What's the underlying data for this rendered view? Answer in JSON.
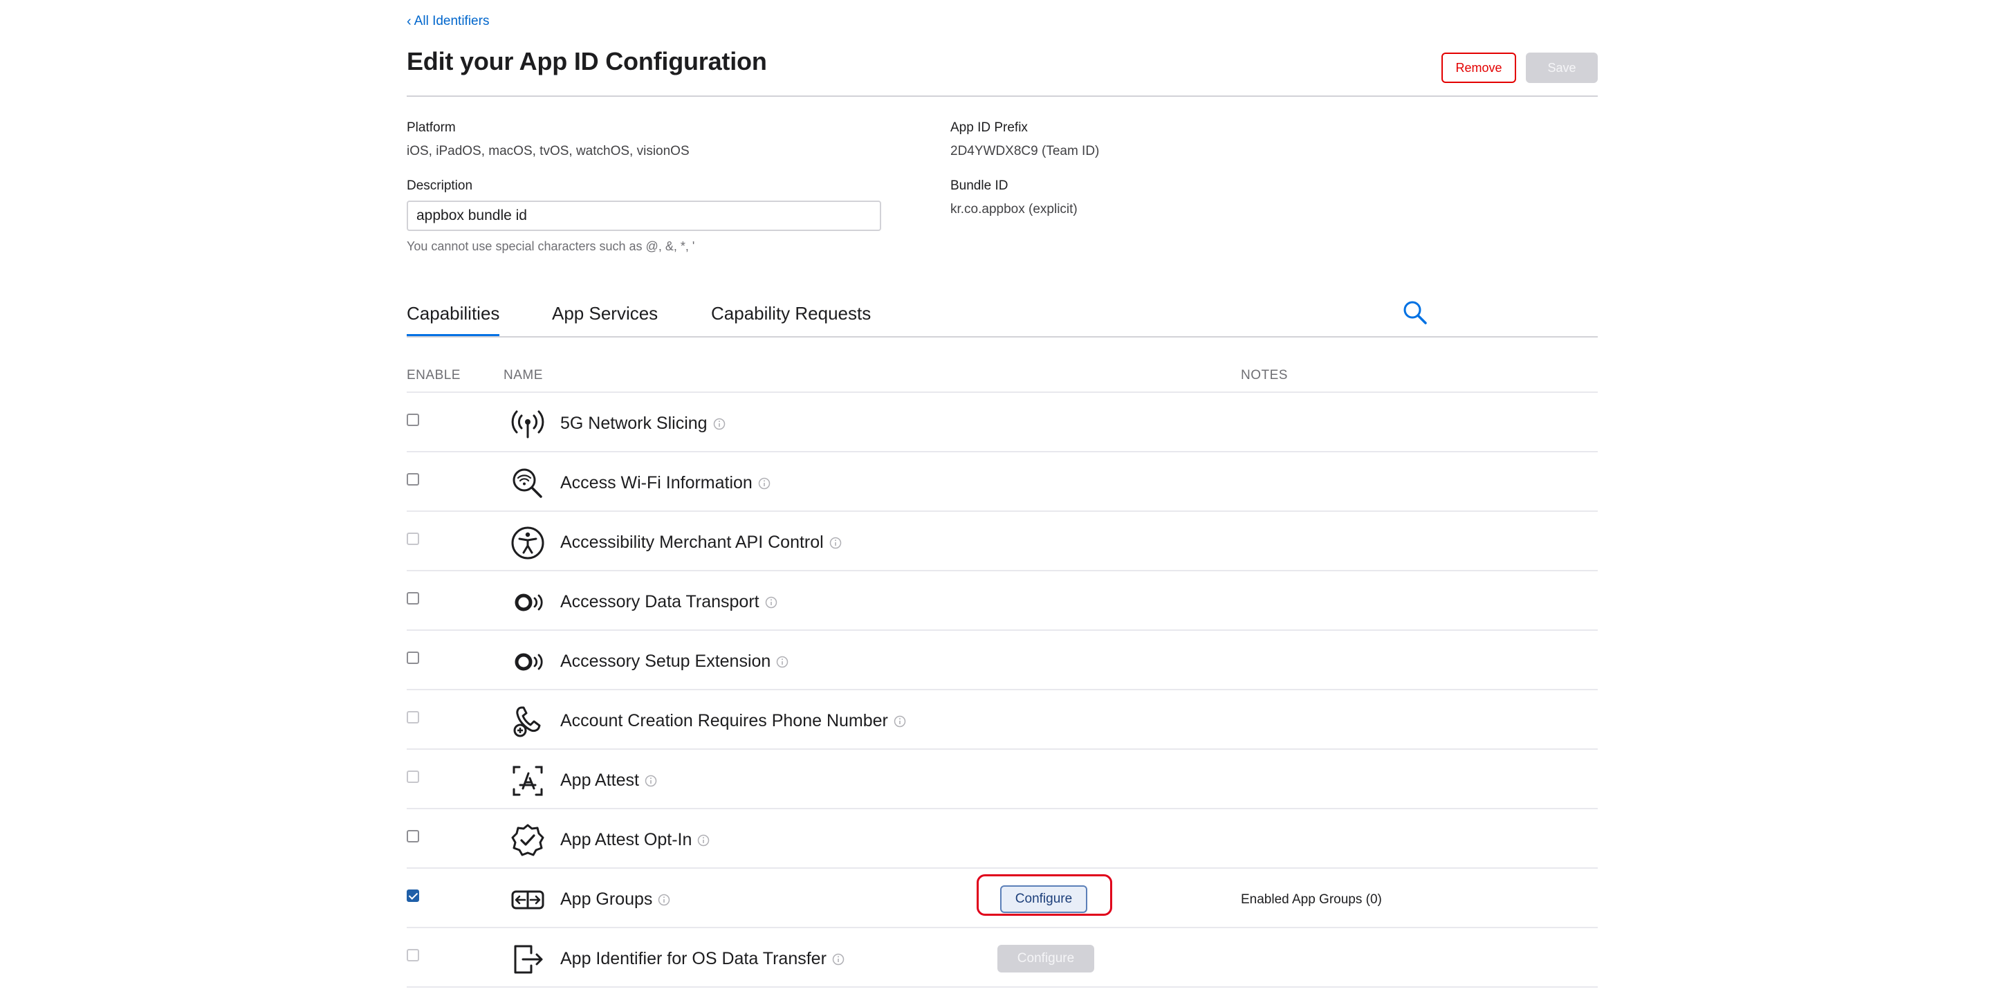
{
  "header": {
    "back_link": "All Identifiers",
    "title": "Edit your App ID Configuration",
    "remove_label": "Remove",
    "save_label": "Save"
  },
  "details": {
    "platform_label": "Platform",
    "platform_value": "iOS, iPadOS, macOS, tvOS, watchOS, visionOS",
    "prefix_label": "App ID Prefix",
    "prefix_value": "2D4YWDX8C9 (Team ID)",
    "description_label": "Description",
    "description_value": "appbox bundle id",
    "description_hint": "You cannot use special characters such as @, &, *, '",
    "bundle_label": "Bundle ID",
    "bundle_value": "kr.co.appbox (explicit)"
  },
  "tabs": [
    {
      "label": "Capabilities",
      "active": true
    },
    {
      "label": "App Services",
      "active": false
    },
    {
      "label": "Capability Requests",
      "active": false
    }
  ],
  "table": {
    "headers": {
      "enable": "ENABLE",
      "name": "NAME",
      "notes": "NOTES"
    },
    "rows": [
      {
        "name": "5G Network Slicing",
        "icon": "antenna-icon",
        "checked": false,
        "enabled": true,
        "configure": null,
        "note": ""
      },
      {
        "name": "Access Wi-Fi Information",
        "icon": "wifi-search-icon",
        "checked": false,
        "enabled": true,
        "configure": null,
        "note": ""
      },
      {
        "name": "Accessibility Merchant API Control",
        "icon": "accessibility-icon",
        "checked": false,
        "enabled": false,
        "configure": null,
        "note": ""
      },
      {
        "name": "Accessory Data Transport",
        "icon": "accessory-icon",
        "checked": false,
        "enabled": true,
        "configure": null,
        "note": ""
      },
      {
        "name": "Accessory Setup Extension",
        "icon": "accessory-icon",
        "checked": false,
        "enabled": true,
        "configure": null,
        "note": ""
      },
      {
        "name": "Account Creation Requires Phone Number",
        "icon": "phone-plus-icon",
        "checked": false,
        "enabled": false,
        "configure": null,
        "note": ""
      },
      {
        "name": "App Attest",
        "icon": "app-attest-icon",
        "checked": false,
        "enabled": false,
        "configure": null,
        "note": ""
      },
      {
        "name": "App Attest Opt-In",
        "icon": "verified-badge-icon",
        "checked": false,
        "enabled": true,
        "configure": null,
        "note": ""
      },
      {
        "name": "App Groups",
        "icon": "app-groups-icon",
        "checked": true,
        "enabled": true,
        "configure": "Configure",
        "configure_enabled": true,
        "note": "Enabled App Groups (0)"
      },
      {
        "name": "App Identifier for OS Data Transfer",
        "icon": "exit-arrow-icon",
        "checked": false,
        "enabled": false,
        "configure": "Configure",
        "configure_enabled": false,
        "note": ""
      }
    ]
  },
  "colors": {
    "accent": "#0071e3",
    "link": "#0066cc",
    "danger": "#e30000",
    "highlight": "#e0001b",
    "divider": "#e8e8ed"
  }
}
